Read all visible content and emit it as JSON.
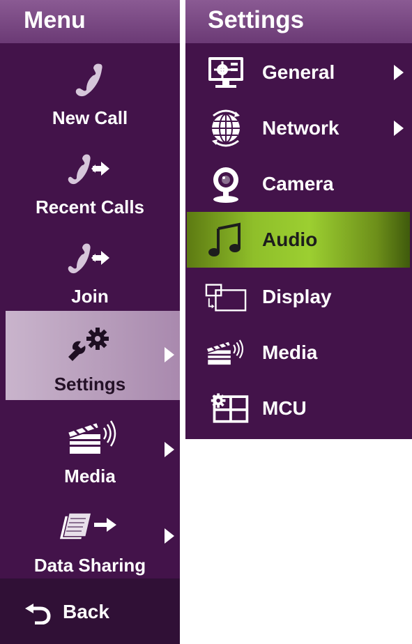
{
  "menu": {
    "title": "Menu",
    "items": [
      {
        "label": "New Call",
        "icon": "phone-icon",
        "has_submenu": false
      },
      {
        "label": "Recent Calls",
        "icon": "phone-transfer-icon",
        "has_submenu": false
      },
      {
        "label": "Join",
        "icon": "phone-transfer-icon",
        "has_submenu": false
      },
      {
        "label": "Settings",
        "icon": "wrench-gear-icon",
        "has_submenu": true,
        "selected": true
      },
      {
        "label": "Media",
        "icon": "clapperboard-icon",
        "has_submenu": true
      },
      {
        "label": "Data Sharing",
        "icon": "document-share-icon",
        "has_submenu": true
      }
    ],
    "back_label": "Back"
  },
  "settings": {
    "title": "Settings",
    "items": [
      {
        "label": "General",
        "icon": "monitor-settings-icon",
        "has_submenu": true
      },
      {
        "label": "Network",
        "icon": "globe-icon",
        "has_submenu": true
      },
      {
        "label": "Camera",
        "icon": "webcam-icon",
        "has_submenu": false
      },
      {
        "label": "Audio",
        "icon": "music-note-icon",
        "has_submenu": false,
        "selected": true
      },
      {
        "label": "Display",
        "icon": "display-layout-icon",
        "has_submenu": false
      },
      {
        "label": "Media",
        "icon": "clapperboard-icon",
        "has_submenu": false
      },
      {
        "label": "MCU",
        "icon": "mcu-grid-icon",
        "has_submenu": false
      }
    ]
  },
  "colors": {
    "panel_bg": "#43134a",
    "header_bg": "#7b4a85",
    "selected_menu": "#c0a8c4",
    "selected_setting": "#8fbf2a",
    "back_bg": "#301036"
  }
}
